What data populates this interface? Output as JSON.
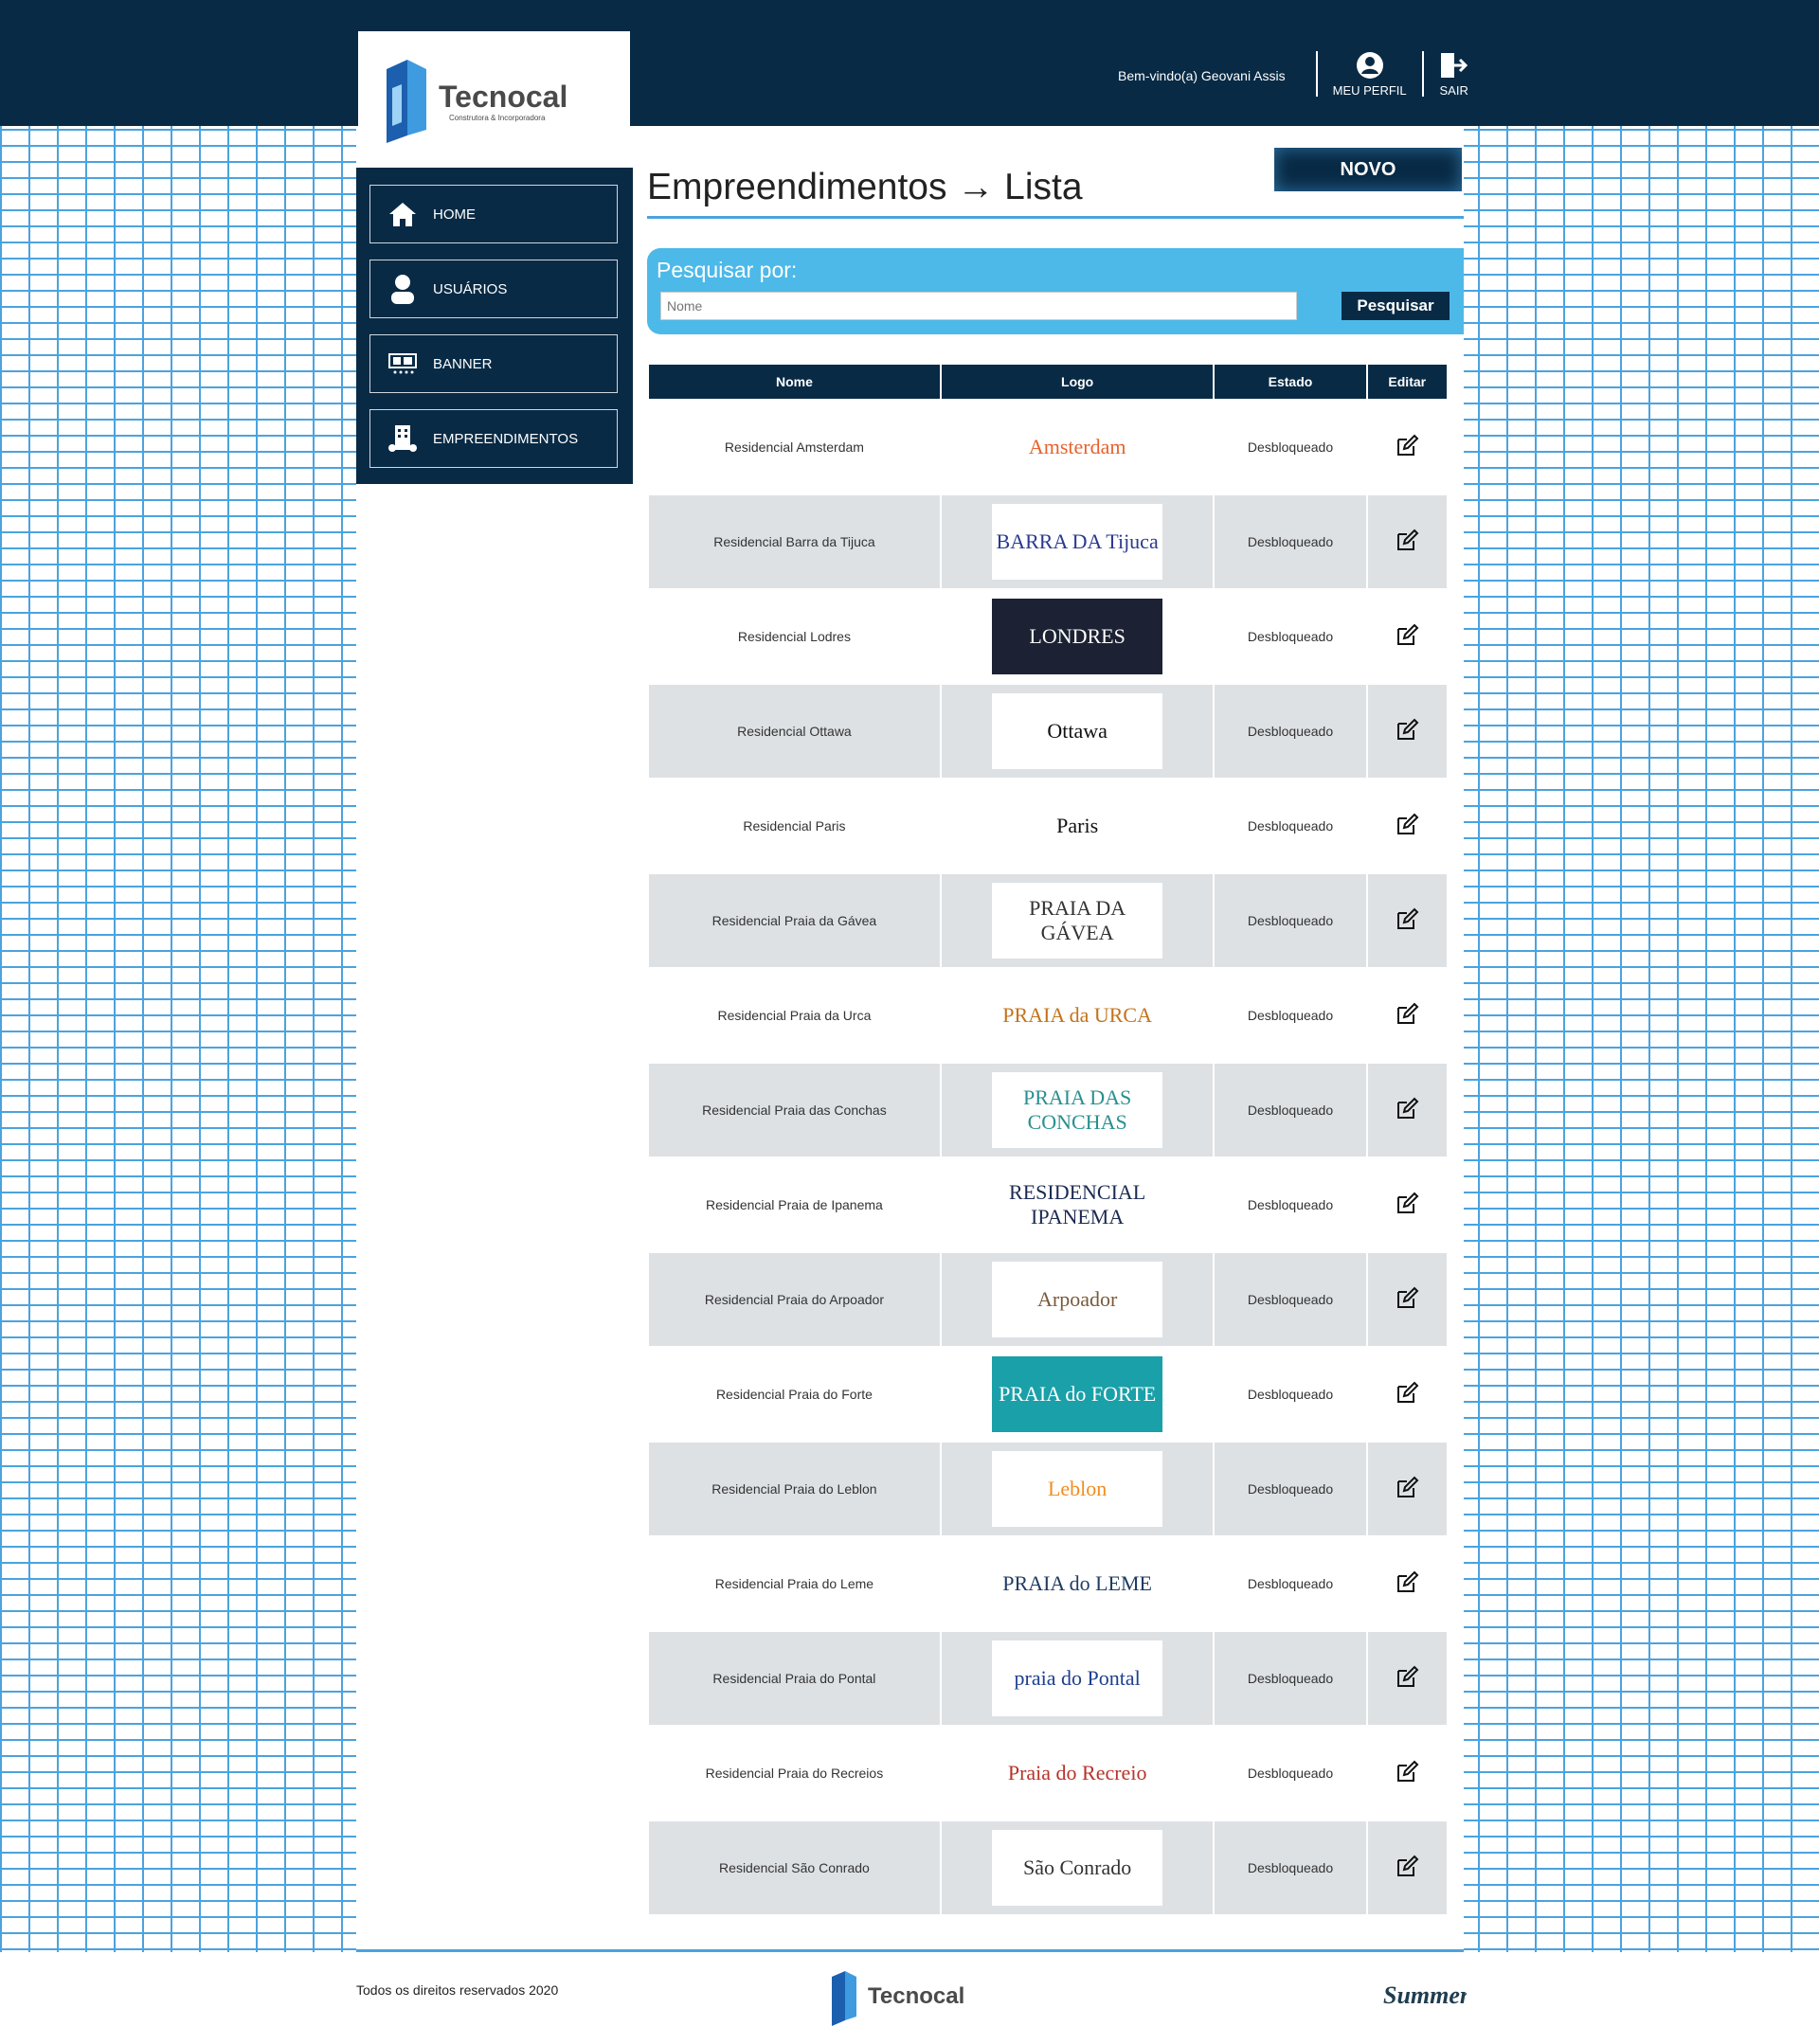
{
  "header": {
    "welcome": "Bem-vindo(a) Geovani Assis",
    "profile_label": "MEU PERFIL",
    "logout_label": "SAIR"
  },
  "brand": {
    "name": "Tecnocal",
    "tagline": "Construtora & Incorporadora"
  },
  "sidebar": {
    "items": [
      {
        "label": "HOME",
        "icon": "home-icon"
      },
      {
        "label": "USUÁRIOS",
        "icon": "user-icon"
      },
      {
        "label": "BANNER",
        "icon": "banner-icon"
      },
      {
        "label": "EMPREENDIMENTOS",
        "icon": "building-icon"
      }
    ]
  },
  "page": {
    "title": "Empreendimentos → Lista",
    "new_button": "NOVO"
  },
  "search": {
    "label": "Pesquisar por:",
    "placeholder": "Nome",
    "button": "Pesquisar"
  },
  "table": {
    "headers": [
      "Nome",
      "Logo",
      "Estado",
      "Editar"
    ],
    "rows": [
      {
        "name": "Residencial Amsterdam",
        "logo": "Amsterdam",
        "color": "#e8622c",
        "status": "Desbloqueado"
      },
      {
        "name": "Residencial Barra da Tijuca",
        "logo": "BARRA DA Tijuca",
        "color": "#2b3a8f",
        "status": "Desbloqueado"
      },
      {
        "name": "Residencial Lodres",
        "logo": "LONDRES",
        "color": "#ffffff",
        "status": "Desbloqueado"
      },
      {
        "name": "Residencial Ottawa",
        "logo": "Ottawa",
        "color": "#111111",
        "status": "Desbloqueado"
      },
      {
        "name": "Residencial Paris",
        "logo": "Paris",
        "color": "#111111",
        "status": "Desbloqueado"
      },
      {
        "name": "Residencial Praia da Gávea",
        "logo": "PRAIA DA GÁVEA",
        "color": "#333333",
        "status": "Desbloqueado"
      },
      {
        "name": "Residencial Praia da Urca",
        "logo": "PRAIA da URCA",
        "color": "#c4731b",
        "status": "Desbloqueado"
      },
      {
        "name": "Residencial Praia das Conchas",
        "logo": "PRAIA DAS CONCHAS",
        "color": "#2a8f8f",
        "status": "Desbloqueado"
      },
      {
        "name": "Residencial Praia de Ipanema",
        "logo": "RESIDENCIAL IPANEMA",
        "color": "#1b2a52",
        "status": "Desbloqueado"
      },
      {
        "name": "Residencial Praia do Arpoador",
        "logo": "Arpoador",
        "color": "#7a5a3c",
        "status": "Desbloqueado"
      },
      {
        "name": "Residencial Praia do Forte",
        "logo": "PRAIA do FORTE",
        "color": "#ffffff",
        "status": "Desbloqueado"
      },
      {
        "name": "Residencial Praia do Leblon",
        "logo": "Leblon",
        "color": "#f28c1e",
        "status": "Desbloqueado"
      },
      {
        "name": "Residencial Praia do Leme",
        "logo": "PRAIA do LEME",
        "color": "#1f3c63",
        "status": "Desbloqueado"
      },
      {
        "name": "Residencial Praia do Pontal",
        "logo": "praia do Pontal",
        "color": "#1d3f8f",
        "status": "Desbloqueado"
      },
      {
        "name": "Residencial Praia do Recreios",
        "logo": "Praia do Recreio",
        "color": "#b8322a",
        "status": "Desbloqueado"
      },
      {
        "name": "Residencial São Conrado",
        "logo": "São Conrado",
        "color": "#333333",
        "status": "Desbloqueado"
      }
    ]
  },
  "footer": {
    "copyright": "Todos os direitos reservados 2020",
    "partner": "Summer"
  }
}
